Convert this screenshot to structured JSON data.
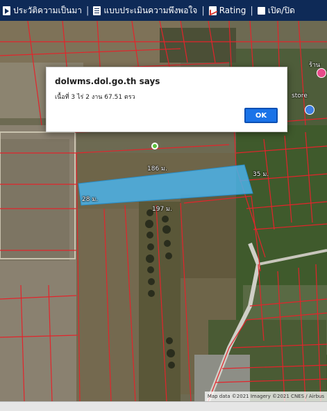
{
  "toolbar": {
    "items": [
      {
        "label": "ประวัติความเป็นมา",
        "icon": "play-icon"
      },
      {
        "label": "แบบประเมินความพึงพอใจ",
        "icon": "document-icon"
      },
      {
        "label": "Rating",
        "icon": "chart-icon"
      },
      {
        "label": "เปิด/ปิด",
        "icon": "checkbox-icon"
      }
    ],
    "separator": "|"
  },
  "map": {
    "attribution": "Map data ©2021 Imagery ©2021 CNES / Airbus",
    "store_label_1": "ร้าน",
    "store_label_2": "store",
    "parcel_highlight_color": "#4bb3ea",
    "parcel_line_color": "#e3242b"
  },
  "parcel": {
    "top_edge": "186 ม.",
    "right_edge": "35 ม.",
    "left_edge": "28 ม.",
    "bottom_edge": "197 ม."
  },
  "dialog": {
    "title": "dolwms.dol.go.th says",
    "message": "เนื้อที่ 3 ไร่ 2 งาน 67.51 ตรว",
    "ok_label": "OK"
  }
}
